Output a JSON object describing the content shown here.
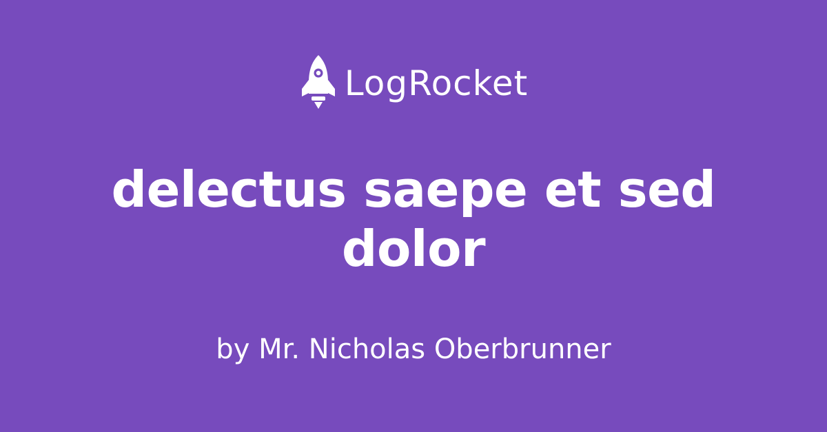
{
  "brand": {
    "name": "LogRocket",
    "icon": "rocket-icon"
  },
  "article": {
    "title_lines": [
      "delectus saepe et sed",
      "dolor"
    ],
    "byline": "by Mr. Nicholas Oberbrunner"
  },
  "colors": {
    "background": "#774bbd",
    "text": "#ffffff"
  }
}
